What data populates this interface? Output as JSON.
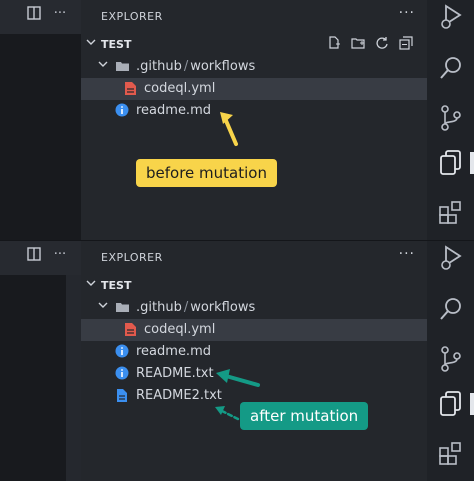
{
  "explorer": {
    "title": "EXPLORER",
    "more": "···",
    "section": "TEST",
    "folder_parent": ".github",
    "folder_sep": "/",
    "folder_child": "workflows",
    "file_codeql": "codeql.yml",
    "file_readme": "readme.md"
  },
  "after": {
    "file_readme_txt": "README.txt",
    "file_readme2_txt": "README2.txt"
  },
  "strip": {
    "split_icon": "split-editor-icon",
    "more": "···"
  },
  "annotations": {
    "before": "before mutation",
    "after": "after mutation"
  },
  "colors": {
    "yellow_callout": "#f8d44a",
    "green_callout": "#149a86",
    "yml_icon": "#e25a4d",
    "info_icon": "#3b8ff0",
    "doc_icon": "#3b8ff0"
  },
  "activity_icons": [
    "run-debug-icon",
    "search-icon",
    "source-control-icon",
    "explorer-icon",
    "extensions-icon"
  ]
}
